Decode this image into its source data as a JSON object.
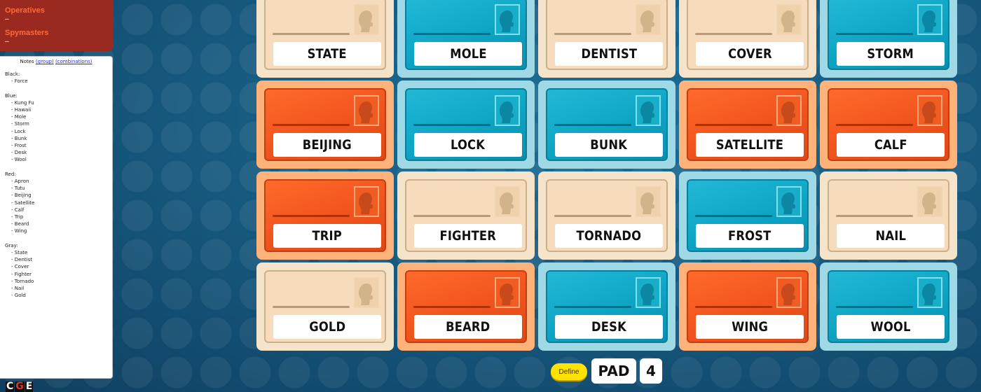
{
  "teams": {
    "operatives_label": "Operatives",
    "operatives_value": "–",
    "spymasters_label": "Spymasters",
    "spymasters_value": "–",
    "accent_color": "#ff6a3d",
    "panel_color": "#9a2a1f"
  },
  "notes": {
    "title": "Notes",
    "link_group": "(group)",
    "link_combinations": "(combinations)",
    "groups": [
      {
        "title": "Black:",
        "items": [
          "Force"
        ]
      },
      {
        "title": "Blue:",
        "items": [
          "Kung Fu",
          "Hawaii",
          "Mole",
          "Storm",
          "Lock",
          "Bunk",
          "Frost",
          "Desk",
          "Wool"
        ]
      },
      {
        "title": "Red:",
        "items": [
          "Apron",
          "Tutu",
          "Beijing",
          "Satellite",
          "Calf",
          "Trip",
          "Beard",
          "Wing"
        ]
      },
      {
        "title": "Gray:",
        "items": [
          "State",
          "Dentist",
          "Cover",
          "Fighter",
          "Tornado",
          "Nail",
          "Gold"
        ]
      }
    ]
  },
  "logo": {
    "letters": [
      "C",
      "G",
      "E"
    ]
  },
  "board": {
    "colors": {
      "blue": "#0ea4c4",
      "red": "#f0541e",
      "gray": "#f6dcbd"
    },
    "cards": [
      {
        "word": "STATE",
        "team": "gray"
      },
      {
        "word": "MOLE",
        "team": "blue"
      },
      {
        "word": "DENTIST",
        "team": "gray"
      },
      {
        "word": "COVER",
        "team": "gray"
      },
      {
        "word": "STORM",
        "team": "blue"
      },
      {
        "word": "BEIJING",
        "team": "red"
      },
      {
        "word": "LOCK",
        "team": "blue"
      },
      {
        "word": "BUNK",
        "team": "blue"
      },
      {
        "word": "SATELLITE",
        "team": "red"
      },
      {
        "word": "CALF",
        "team": "red"
      },
      {
        "word": "TRIP",
        "team": "red"
      },
      {
        "word": "FIGHTER",
        "team": "gray"
      },
      {
        "word": "TORNADO",
        "team": "gray"
      },
      {
        "word": "FROST",
        "team": "blue"
      },
      {
        "word": "NAIL",
        "team": "gray"
      },
      {
        "word": "GOLD",
        "team": "gray"
      },
      {
        "word": "BEARD",
        "team": "red"
      },
      {
        "word": "DESK",
        "team": "blue"
      },
      {
        "word": "WING",
        "team": "red"
      },
      {
        "word": "WOOL",
        "team": "blue"
      }
    ]
  },
  "controls": {
    "define_label": "Define",
    "clue_word": "PAD",
    "clue_number": "4"
  }
}
